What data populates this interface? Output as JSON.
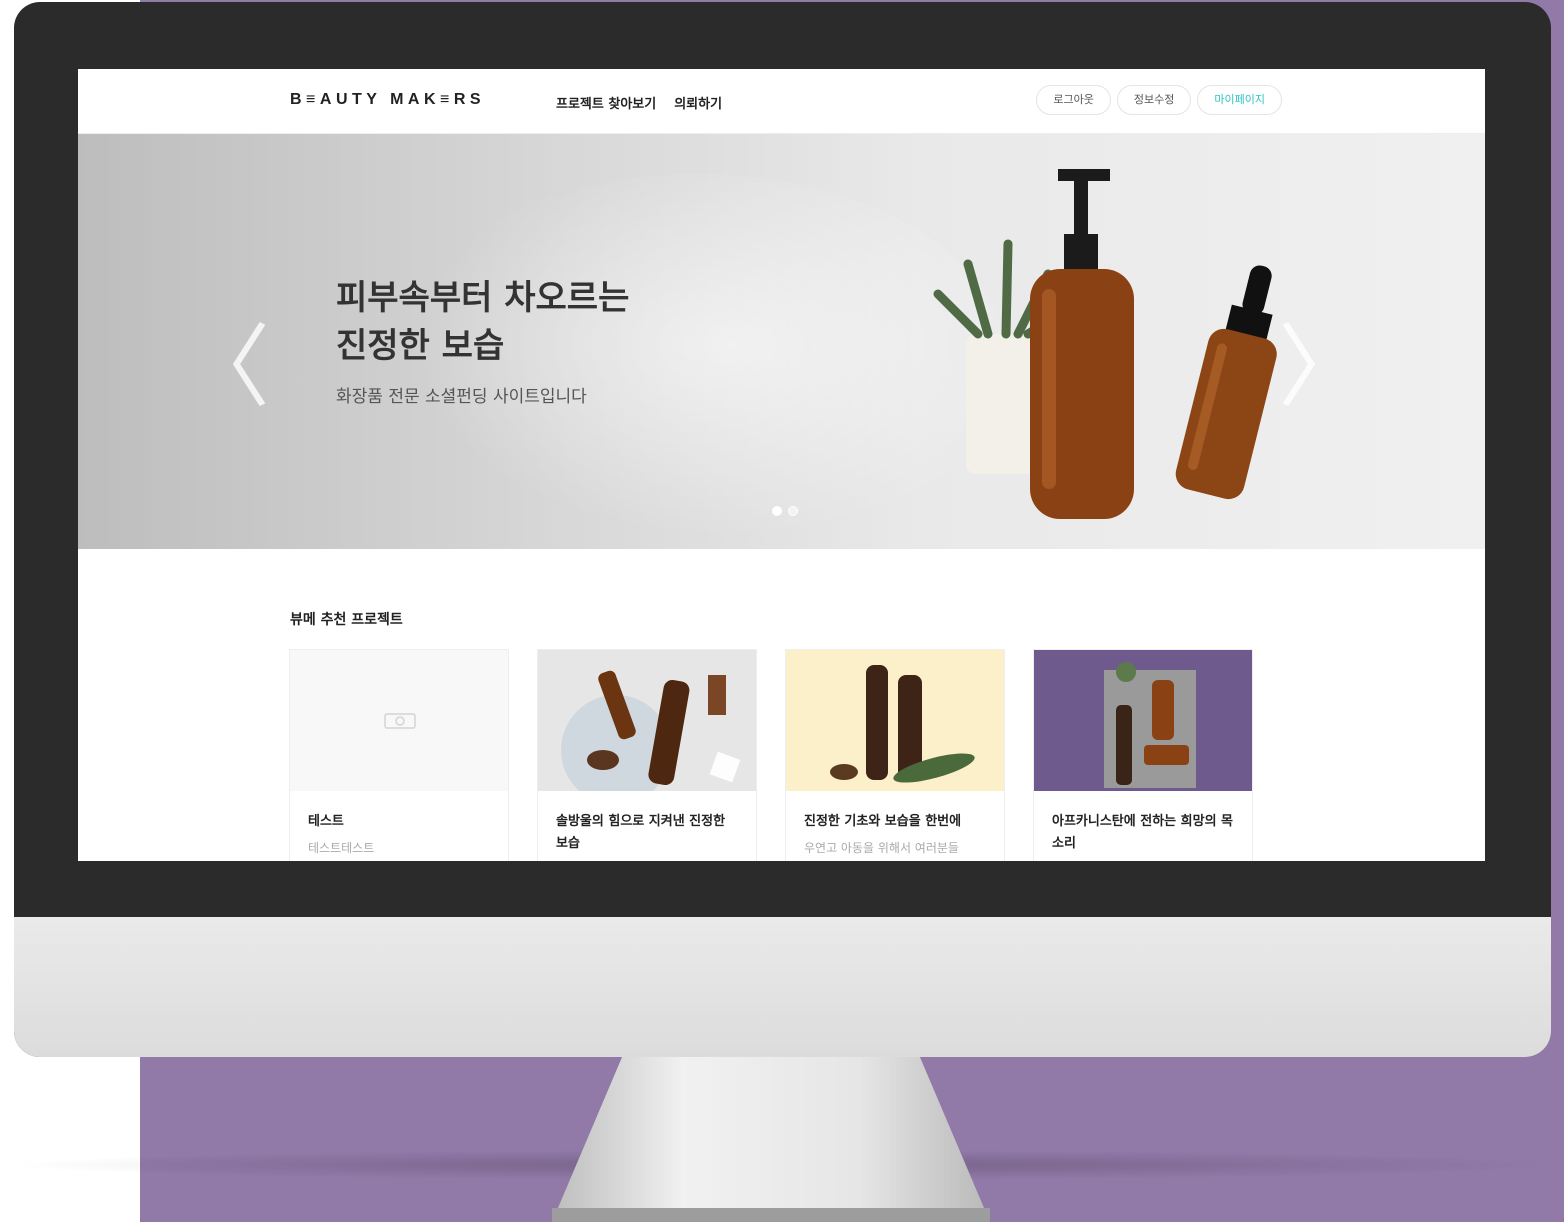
{
  "header": {
    "logo": "B≡AUTY MAK≡RS",
    "nav": [
      "프로젝트 찾아보기",
      "의뢰하기"
    ],
    "buttons": [
      "로그아웃",
      "정보수정",
      "마이페이지"
    ]
  },
  "hero": {
    "title": "피부속부터 차오르는\n진정한 보습",
    "subtitle": "화장품 전문 소셜펀딩 사이트입니다",
    "arrows": {
      "left": "〈",
      "right": "〉"
    },
    "slide_count": 2,
    "active_slide": 1
  },
  "section": {
    "title": "뷰메 추천 프로젝트",
    "cards": [
      {
        "title": "테스트",
        "desc": "테스트테스트",
        "image": "placeholder-camera-icon"
      },
      {
        "title": "솔방울의 힘으로 지켜낸 진정한 보습",
        "desc": "",
        "image": "amber-bottles-on-grey"
      },
      {
        "title": "진정한 기초와 보습을 한번에",
        "desc": "우연고 아동을 위해서 여러분들",
        "image": "amber-bottles-on-cream"
      },
      {
        "title": "아프카니스탄에 전하는 희망의 목소리",
        "desc": "",
        "image": "amber-bottles-on-purple"
      }
    ]
  },
  "colors": {
    "background": "#9179a8",
    "accent": "#2fc3c4",
    "bezel": "#2b2b2b"
  }
}
